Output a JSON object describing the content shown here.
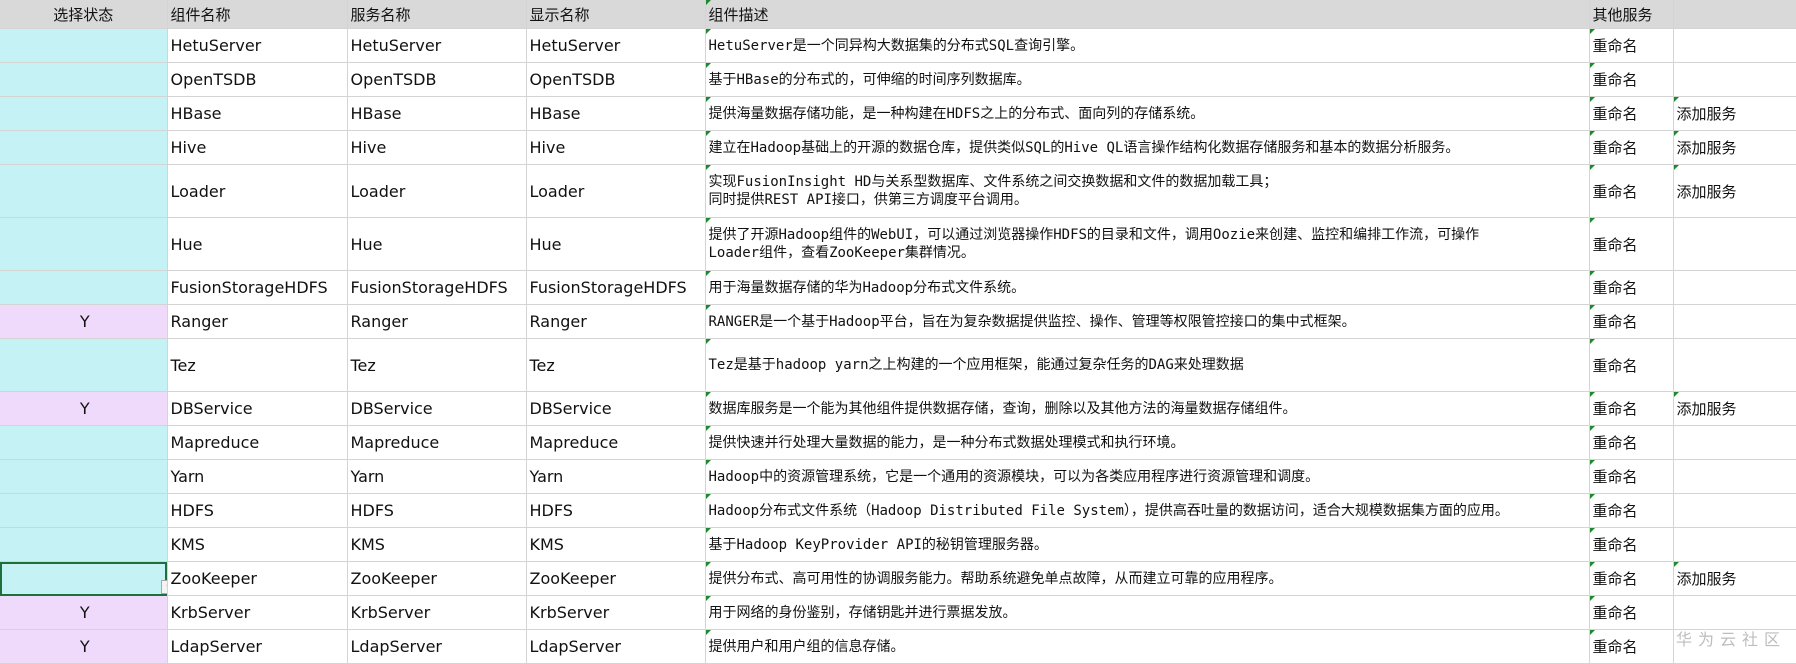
{
  "columns": {
    "select": "选择状态",
    "component": "组件名称",
    "service": "服务名称",
    "display": "显示名称",
    "desc": "组件描述",
    "other": "其他服务"
  },
  "rows": [
    {
      "select": "",
      "component": "HetuServer",
      "service": "HetuServer",
      "display": "HetuServer",
      "desc": "HetuServer是一个同异构大数据集的分布式SQL查询引擎。",
      "rename": "重命名",
      "add": ""
    },
    {
      "select": "",
      "component": "OpenTSDB",
      "service": "OpenTSDB",
      "display": "OpenTSDB",
      "desc": "基于HBase的分布式的，可伸缩的时间序列数据库。",
      "rename": "重命名",
      "add": ""
    },
    {
      "select": "",
      "component": "HBase",
      "service": "HBase",
      "display": "HBase",
      "desc": "提供海量数据存储功能，是一种构建在HDFS之上的分布式、面向列的存储系统。",
      "rename": "重命名",
      "add": "添加服务"
    },
    {
      "select": "",
      "component": "Hive",
      "service": "Hive",
      "display": "Hive",
      "desc": "建立在Hadoop基础上的开源的数据仓库，提供类似SQL的Hive QL语言操作结构化数据存储服务和基本的数据分析服务。",
      "rename": "重命名",
      "add": "添加服务"
    },
    {
      "select": "",
      "component": "Loader",
      "service": "Loader",
      "display": "Loader",
      "desc": "实现FusionInsight HD与关系型数据库、文件系统之间交换数据和文件的数据加载工具；",
      "desc2": "同时提供REST API接口，供第三方调度平台调用。",
      "rename": "重命名",
      "add": "添加服务"
    },
    {
      "select": "",
      "component": "Hue",
      "service": "Hue",
      "display": "Hue",
      "desc": "提供了开源Hadoop组件的WebUI，可以通过浏览器操作HDFS的目录和文件，调用Oozie来创建、监控和编排工作流，可操作",
      "desc2": "Loader组件，查看ZooKeeper集群情况。",
      "rename": "重命名",
      "add": ""
    },
    {
      "select": "",
      "component": "FusionStorageHDFS",
      "service": "FusionStorageHDFS",
      "display": "FusionStorageHDFS",
      "desc": "用于海量数据存储的华为Hadoop分布式文件系统。",
      "rename": "重命名",
      "add": ""
    },
    {
      "select": "Y",
      "component": "Ranger",
      "service": "Ranger",
      "display": "Ranger",
      "desc": "RANGER是一个基于Hadoop平台，旨在为复杂数据提供监控、操作、管理等权限管控接口的集中式框架。",
      "rename": "重命名",
      "add": ""
    },
    {
      "select": "",
      "component": "Tez",
      "service": "Tez",
      "display": "Tez",
      "desc": "Tez是基于hadoop yarn之上构建的一个应用框架，能通过复杂任务的DAG来处理数据",
      "rename": "重命名",
      "add": ""
    },
    {
      "select": "Y",
      "component": "DBService",
      "service": "DBService",
      "display": "DBService",
      "desc": "数据库服务是一个能为其他组件提供数据存储，查询，删除以及其他方法的海量数据存储组件。",
      "rename": "重命名",
      "add": "添加服务"
    },
    {
      "select": "",
      "component": "Mapreduce",
      "service": "Mapreduce",
      "display": "Mapreduce",
      "desc": "提供快速并行处理大量数据的能力，是一种分布式数据处理模式和执行环境。",
      "rename": "重命名",
      "add": ""
    },
    {
      "select": "",
      "component": "Yarn",
      "service": "Yarn",
      "display": "Yarn",
      "desc": "Hadoop中的资源管理系统，它是一个通用的资源模块，可以为各类应用程序进行资源管理和调度。",
      "rename": "重命名",
      "add": ""
    },
    {
      "select": "",
      "component": "HDFS",
      "service": "HDFS",
      "display": "HDFS",
      "desc": "Hadoop分布式文件系统（Hadoop Distributed File System），提供高吞吐量的数据访问，适合大规模数据集方面的应用。",
      "rename": "重命名",
      "add": ""
    },
    {
      "select": "",
      "component": "KMS",
      "service": "KMS",
      "display": "KMS",
      "desc": "基于Hadoop KeyProvider API的秘钥管理服务器。",
      "rename": "重命名",
      "add": ""
    },
    {
      "select": "",
      "component": "ZooKeeper",
      "service": "ZooKeeper",
      "display": "ZooKeeper",
      "desc": "提供分布式、高可用性的协调服务能力。帮助系统避免单点故障，从而建立可靠的应用程序。",
      "rename": "重命名",
      "add": "添加服务"
    },
    {
      "select": "Y",
      "component": "KrbServer",
      "service": "KrbServer",
      "display": "KrbServer",
      "desc": "用于网络的身份鉴别，存储钥匙并进行票据发放。",
      "rename": "重命名",
      "add": ""
    },
    {
      "select": "Y",
      "component": "LdapServer",
      "service": "LdapServer",
      "display": "LdapServer",
      "desc": "提供用户和用户组的信息存储。",
      "rename": "重命名",
      "add": ""
    }
  ],
  "watermark": "华为云社区",
  "colors": {
    "unselected_fill": "#c5f2f5",
    "selected_fill": "#efdafb",
    "header_fill": "#d9d9d9",
    "comment_marker": "#1c8a2c"
  }
}
